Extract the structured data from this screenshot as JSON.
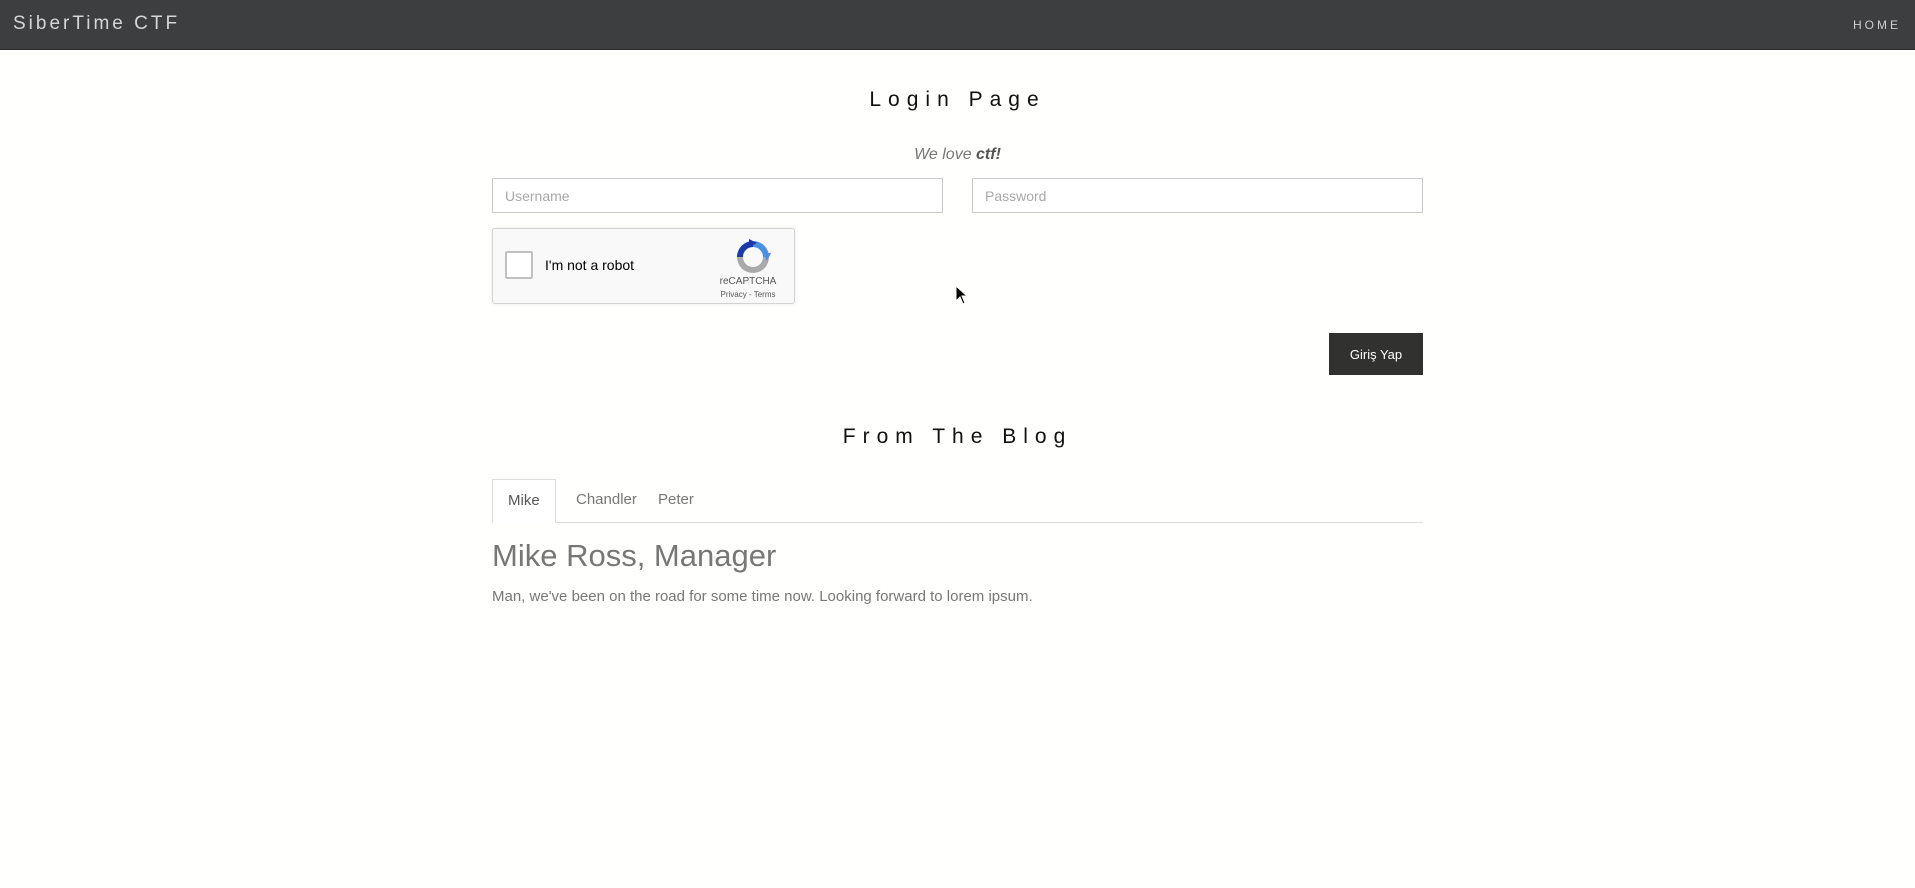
{
  "navbar": {
    "brand": "SiberTime CTF",
    "home_link": "HOME"
  },
  "login": {
    "title": "Login Page",
    "tagline_prefix": "We love ",
    "tagline_bold": "ctf!",
    "username_placeholder": "Username",
    "password_placeholder": "Password",
    "submit_label": "Giriş Yap"
  },
  "captcha": {
    "label": "I'm not a robot",
    "brand": "reCAPTCHA",
    "links": "Privacy - Terms"
  },
  "blog": {
    "title": "From The Blog",
    "tabs": [
      {
        "label": "Mike",
        "active": true
      },
      {
        "label": "Chandler",
        "active": false
      },
      {
        "label": "Peter",
        "active": false
      }
    ],
    "active_heading": "Mike Ross, Manager",
    "active_text": "Man, we've been on the road for some time now. Looking forward to lorem ipsum."
  },
  "colors": {
    "navbar_bg": "#3d3e40",
    "button_bg": "#313130",
    "page_bg": "#fffffd"
  }
}
